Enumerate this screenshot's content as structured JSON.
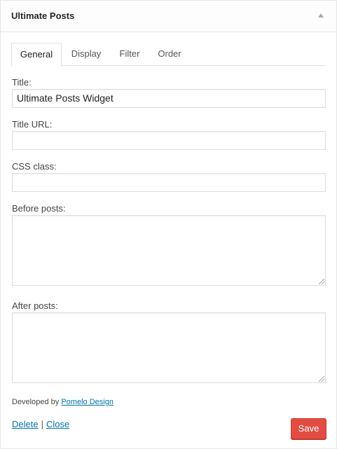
{
  "widget": {
    "title": "Ultimate Posts"
  },
  "tabs": [
    "General",
    "Display",
    "Filter",
    "Order"
  ],
  "fields": {
    "title_label": "Title:",
    "title_value": "Ultimate Posts Widget",
    "title_url_label": "Title URL:",
    "title_url_value": "",
    "css_class_label": "CSS class:",
    "css_class_value": "",
    "before_posts_label": "Before posts:",
    "after_posts_label": "After posts:"
  },
  "footer": {
    "developed_by": "Developed by",
    "developer_link": "Pomelo Design",
    "delete": "Delete",
    "separator": "|",
    "close": "Close",
    "save": "Save"
  },
  "colors": {
    "save_button": "#e14d43",
    "link": "#0073aa"
  }
}
